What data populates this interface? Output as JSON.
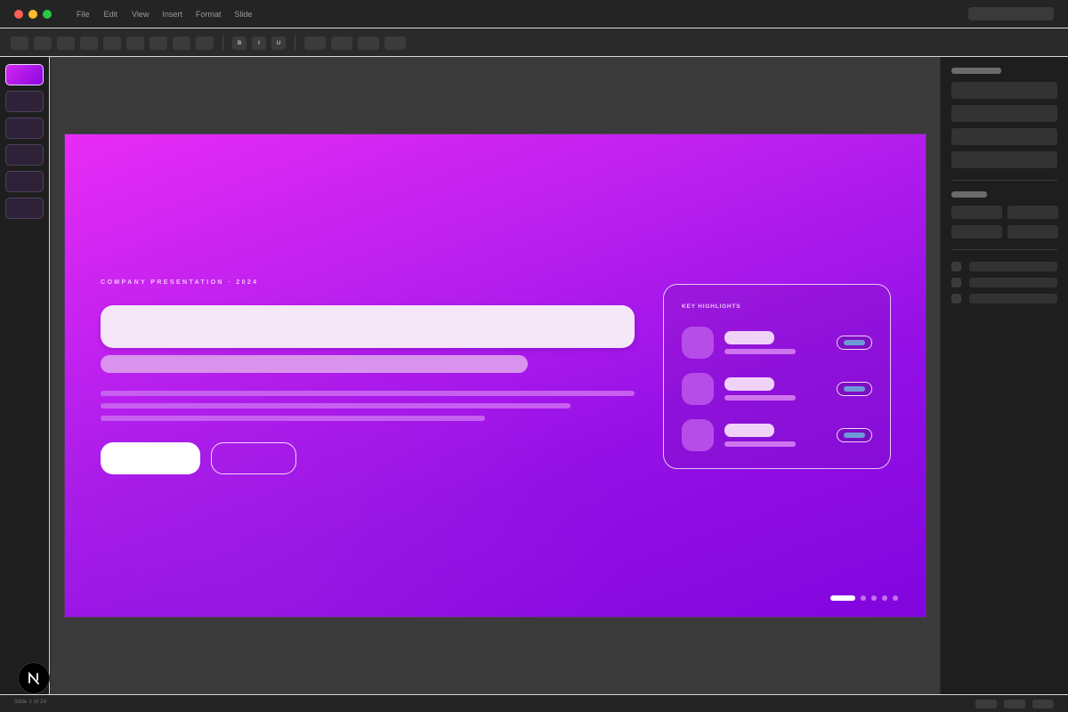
{
  "menu": {
    "file": "File",
    "edit": "Edit",
    "view": "View",
    "insert": "Insert",
    "format": "Format",
    "slide": "Slide"
  },
  "toolbar": {
    "bold": "B",
    "italic": "I",
    "underline": "U"
  },
  "slide": {
    "kicker": "COMPANY PRESENTATION · 2024",
    "highlights_title": "KEY HIGHLIGHTS",
    "highlight_count": 3,
    "page_dots": 5,
    "active_dot": 0
  },
  "slides_panel": {
    "count": 6,
    "active_index": 0
  },
  "status": {
    "slide_counter": "Slide 1 of 24"
  },
  "colors": {
    "accent_gradient_start": "#e82bf5",
    "accent_gradient_end": "#8205de",
    "app_background": "#2b2b2b"
  },
  "icons": {
    "logo": "n-logo-icon"
  }
}
